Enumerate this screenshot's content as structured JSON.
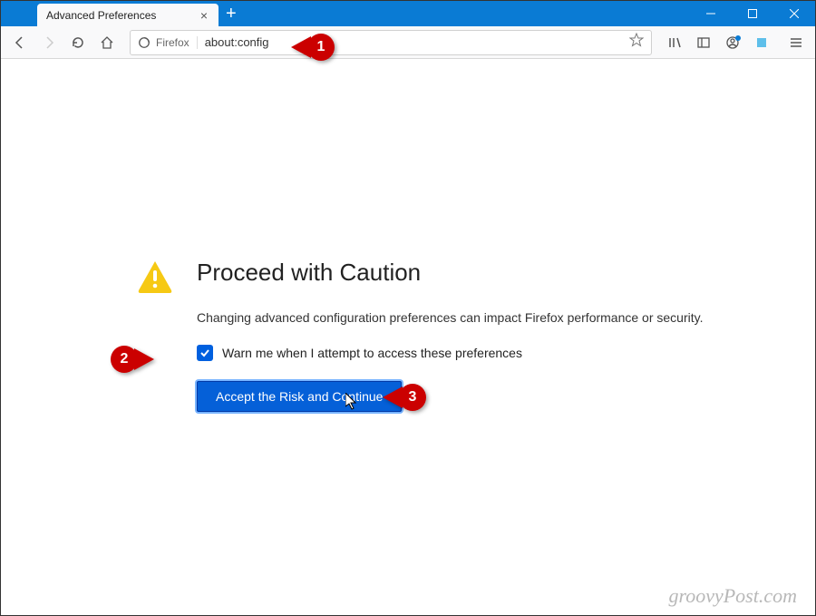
{
  "tab": {
    "title": "Advanced Preferences"
  },
  "urlbar": {
    "identity": "Firefox",
    "url": "about:config"
  },
  "page": {
    "heading": "Proceed with Caution",
    "description": "Changing advanced configuration preferences can impact Firefox performance or security.",
    "checkbox_label": "Warn me when I attempt to access these preferences",
    "accept_button": "Accept the Risk and Continue"
  },
  "annotations": {
    "a1": "1",
    "a2": "2",
    "a3": "3"
  },
  "watermark": "groovyPost.com"
}
